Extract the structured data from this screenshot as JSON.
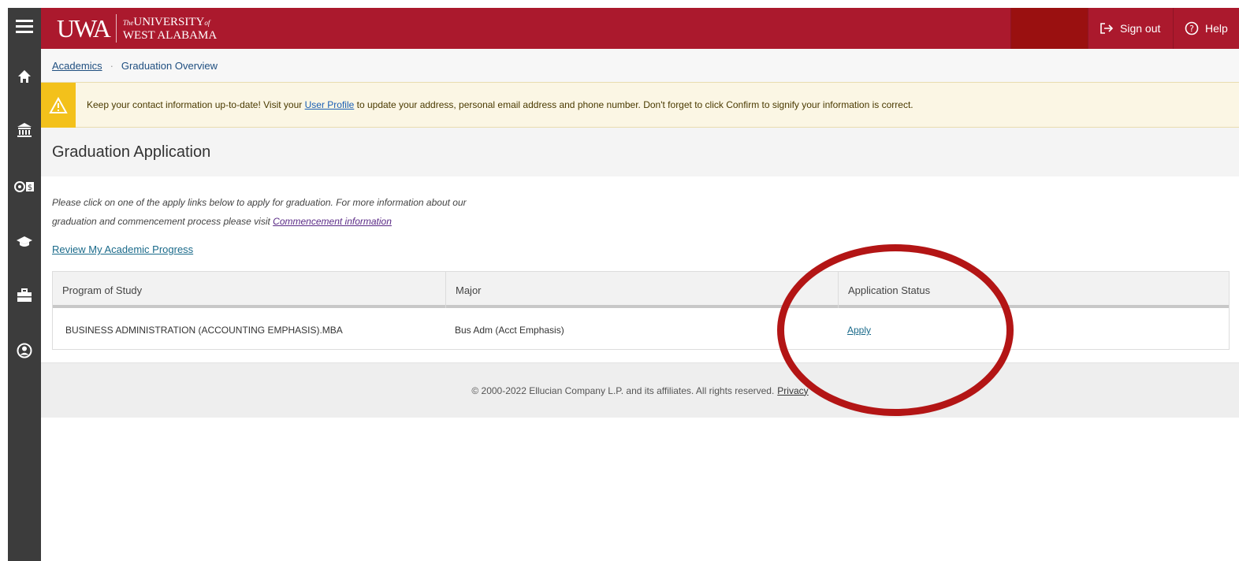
{
  "sidebar": {
    "icons": [
      "menu-icon",
      "home-icon",
      "bank-icon",
      "finance-icon",
      "graduation-cap-icon",
      "briefcase-icon",
      "person-icon"
    ]
  },
  "header": {
    "logo_mark": "UWA",
    "logo_small": "The",
    "logo_line1": "UNIVERSITY",
    "logo_small2": "of",
    "logo_line2": "WEST ALABAMA",
    "sign_out": "Sign out",
    "help": "Help",
    "color": "#ab192d"
  },
  "breadcrumb": {
    "parent": "Academics",
    "current": "Graduation Overview"
  },
  "alert": {
    "text_before": "Keep your contact information up-to-date! Visit your",
    "link": "User Profile",
    "text_after": "to update your address, personal email address and phone number. Don't forget to click Confirm to signify your information is correct."
  },
  "page": {
    "title": "Graduation Application",
    "intro_line1": "Please click on one of the apply links below to apply for graduation. For more information about our",
    "intro_line2": "graduation and commencement process please visit",
    "intro_link": "Commencement information",
    "progress_link": "Review My Academic Progress"
  },
  "table": {
    "headers": [
      "Program of Study",
      "Major",
      "Application Status"
    ],
    "rows": [
      {
        "program": "BUSINESS ADMINISTRATION (ACCOUNTING EMPHASIS).MBA",
        "major": "Bus Adm (Acct Emphasis)",
        "status": "Apply"
      }
    ]
  },
  "footer": {
    "copyright": "© 2000-2022 Ellucian Company L.P. and its affiliates. All rights reserved.",
    "privacy": "Privacy"
  }
}
